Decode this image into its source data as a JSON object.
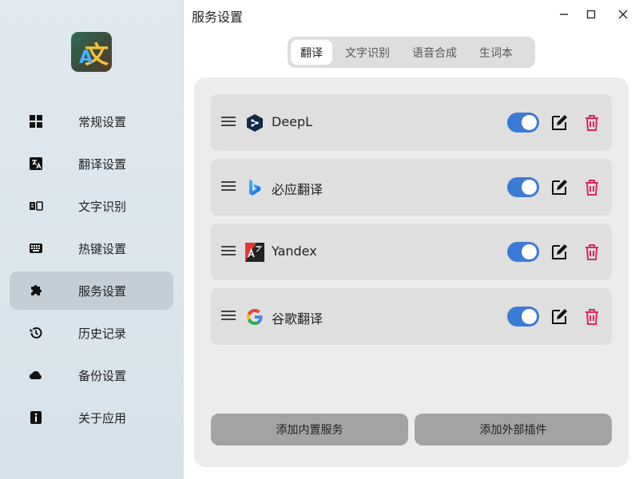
{
  "window": {
    "title": "服务设置",
    "minimize_icon": "minimize-icon",
    "maximize_icon": "maximize-icon",
    "close_icon": "close-icon"
  },
  "sidebar": {
    "logo": {
      "glyph_a": "A",
      "glyph_wen": "文"
    },
    "items": [
      {
        "label": "常规设置",
        "icon": "grid-icon",
        "active": false
      },
      {
        "label": "翻译设置",
        "icon": "translate-icon",
        "active": false
      },
      {
        "label": "文字识别",
        "icon": "ocr-icon",
        "active": false
      },
      {
        "label": "热键设置",
        "icon": "keyboard-icon",
        "active": false
      },
      {
        "label": "服务设置",
        "icon": "puzzle-icon",
        "active": true
      },
      {
        "label": "历史记录",
        "icon": "history-icon",
        "active": false
      },
      {
        "label": "备份设置",
        "icon": "cloud-icon",
        "active": false
      },
      {
        "label": "关于应用",
        "icon": "info-icon",
        "active": false
      }
    ]
  },
  "tabs": [
    {
      "label": "翻译",
      "active": true
    },
    {
      "label": "文字识别",
      "active": false
    },
    {
      "label": "语音合成",
      "active": false
    },
    {
      "label": "生词本",
      "active": false
    }
  ],
  "services": [
    {
      "name": "DeepL",
      "icon": "deepl-icon",
      "enabled": true
    },
    {
      "name": "必应翻译",
      "icon": "bing-icon",
      "enabled": true
    },
    {
      "name": "Yandex",
      "icon": "yandex-icon",
      "enabled": true
    },
    {
      "name": "谷歌翻译",
      "icon": "google-icon",
      "enabled": true
    }
  ],
  "actions": {
    "add_builtin": "添加内置服务",
    "add_external": "添加外部插件"
  },
  "colors": {
    "accent": "#3a7bd5",
    "delete": "#e0245e",
    "sidebar_active": "#c3ced7"
  }
}
